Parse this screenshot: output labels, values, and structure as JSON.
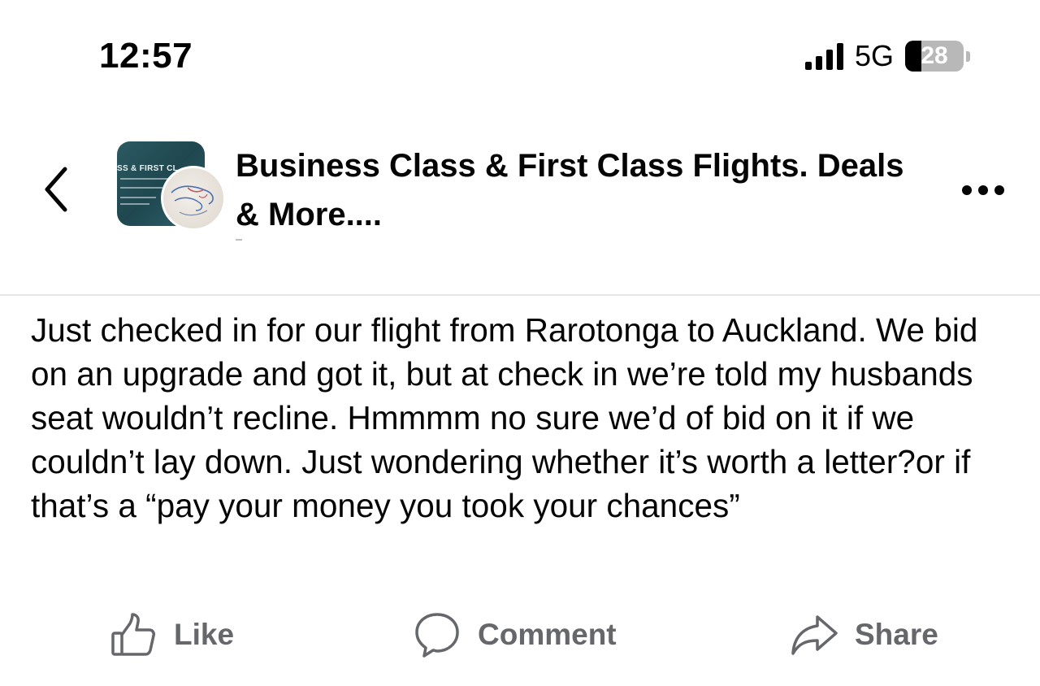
{
  "status_bar": {
    "time": "12:57",
    "network": "5G",
    "battery": "28",
    "battery_level": 0.28
  },
  "header": {
    "group_name": "Business Class & First Class Flights. Deals & More....",
    "avatar_banner": "SS & FIRST CL",
    "back_icon": "chevron-left-icon",
    "more_icon": "more-horizontal-icon"
  },
  "post": {
    "text": "Just checked in for our flight from Rarotonga to Auckland. We bid on an upgrade and got it, but at check in we’re told my husbands seat wouldn’t recline. Hmmmm no sure we’d of bid on it if we couldn’t lay down. Just wondering whether it’s worth a letter?or if that’s a “pay your money you took your chances”"
  },
  "actions": {
    "like": {
      "label": "Like",
      "icon": "thumbs-up-icon"
    },
    "comment": {
      "label": "Comment",
      "icon": "comment-bubble-icon"
    },
    "share": {
      "label": "Share",
      "icon": "share-arrow-icon"
    }
  },
  "colors": {
    "text": "#050505",
    "secondary_text": "#65676b",
    "divider": "#e4e6eb",
    "avatar_teal": "#2c5a63"
  }
}
